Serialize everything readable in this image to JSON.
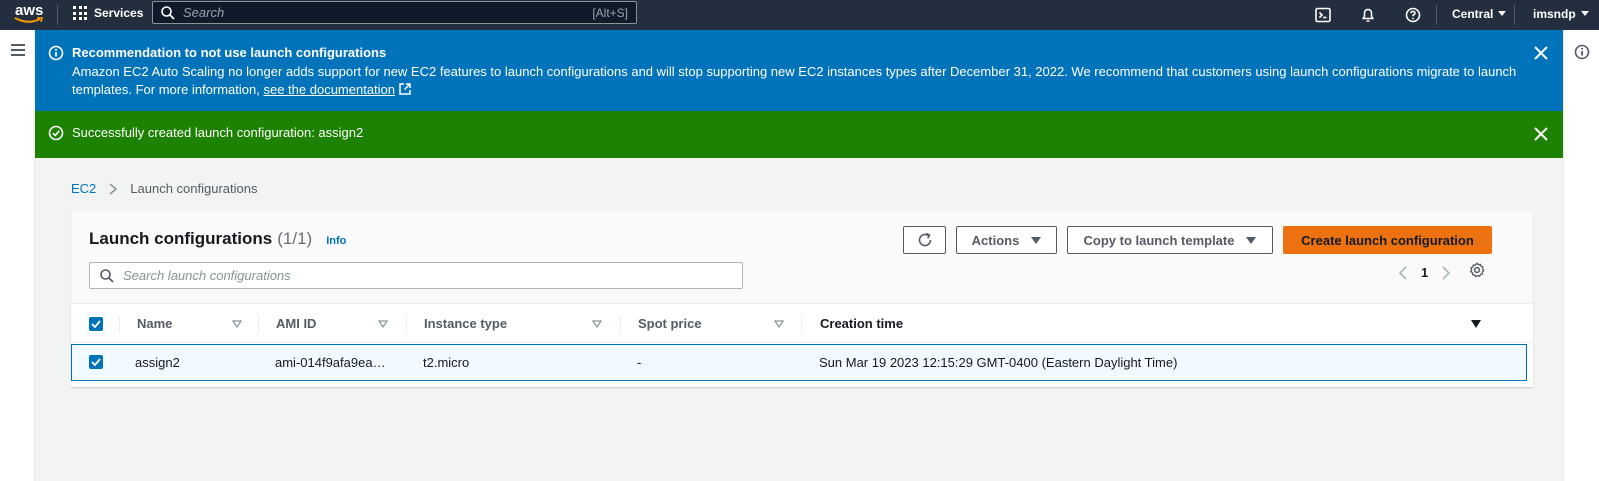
{
  "topnav": {
    "logo": "aws",
    "services_label": "Services",
    "search_placeholder": "Search",
    "search_shortcut": "[Alt+S]",
    "region": "Central",
    "user": "imsndp"
  },
  "flash_info": {
    "title": "Recommendation to not use launch configurations",
    "body": "Amazon EC2 Auto Scaling no longer adds support for new EC2 features to launch configurations and will stop supporting new EC2 instances types after December 31, 2022. We recommend that customers using launch configurations migrate to launch templates. For more information,",
    "link": "see the documentation"
  },
  "flash_success": {
    "message": "Successfully created launch configuration: assign2"
  },
  "breadcrumb": {
    "root": "EC2",
    "current": "Launch configurations"
  },
  "panel": {
    "title": "Launch configurations",
    "count": "(1/1)",
    "info": "Info",
    "actions_label": "Actions",
    "copy_label": "Copy to launch template",
    "create_label": "Create launch configuration",
    "search_placeholder": "Search launch configurations",
    "page": "1"
  },
  "table": {
    "columns": [
      "Name",
      "AMI ID",
      "Instance type",
      "Spot price",
      "Creation time"
    ],
    "rows": [
      {
        "name": "assign2",
        "ami": "ami-014f9afa9ea…",
        "instance_type": "t2.micro",
        "spot_price": "-",
        "creation_time": "Sun Mar 19 2023 12:15:29 GMT-0400 (Eastern Daylight Time)",
        "selected": true
      }
    ]
  },
  "colors": {
    "nav_bg": "#232f3e",
    "info_bg": "#0073bb",
    "success_bg": "#1d8102",
    "primary_btn": "#ec7211",
    "link": "#0073bb"
  }
}
